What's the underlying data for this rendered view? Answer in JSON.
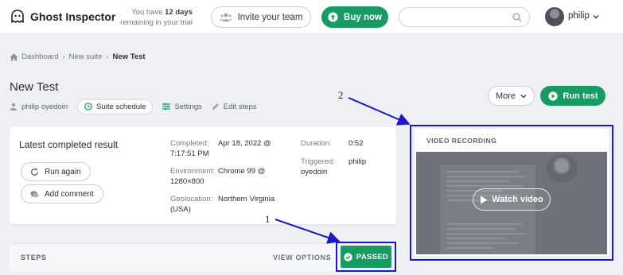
{
  "app": {
    "name": "Ghost Inspector"
  },
  "header": {
    "trial_prefix": "You have",
    "trial_days": "12 days",
    "trial_suffix": "remaining in your trial",
    "invite_label": "Invite your team",
    "buy_label": "Buy now",
    "search_placeholder": "",
    "user_name": "philip"
  },
  "breadcrumb": {
    "items": [
      "Dashboard",
      "New suite"
    ],
    "current": "New Test"
  },
  "test": {
    "title": "New Test",
    "owner": "philip oyedoin",
    "schedule_label": "Suite schedule",
    "settings_label": "Settings",
    "edit_steps_label": "Edit steps",
    "more_label": "More",
    "run_label": "Run test"
  },
  "result": {
    "title": "Latest completed result",
    "run_again_label": "Run again",
    "add_comment_label": "Add comment",
    "completed_label": "Completed:",
    "completed_value": "Apr 18, 2022 @ 7:17:51 PM",
    "environment_label": "Environment:",
    "environment_value": "Chrome 99 @ 1280×800",
    "geolocation_label": "Geolocation:",
    "geolocation_value": "Northern Virginia (USA)",
    "duration_label": "Duration:",
    "duration_value": "0:52",
    "triggered_label": "Triggered:",
    "triggered_value": "philip oyedoin"
  },
  "steps": {
    "label": "STEPS",
    "view_options_label": "VIEW OPTIONS",
    "status_label": "PASSED"
  },
  "video": {
    "title": "VIDEO RECORDING",
    "watch_label": "Watch video"
  },
  "annotations": {
    "one": "1",
    "two": "2"
  },
  "colors": {
    "brand_green": "#169c63",
    "annotation_blue": "#1a18c8"
  }
}
